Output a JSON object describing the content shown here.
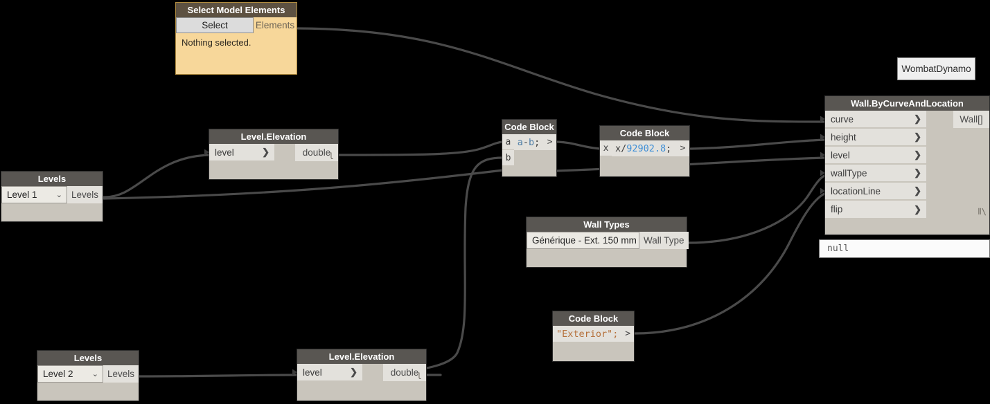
{
  "app": {
    "background": "#000000",
    "wire_color": "#4a4a4a",
    "header_color": "#595652",
    "node_body_color": "#c9c5bc",
    "port_color": "#e3e1dc",
    "select_node_color": "#f7d79a"
  },
  "nodes": {
    "select_model_elements": {
      "title": "Select Model Elements",
      "button_label": "Select",
      "output_label": "Elements",
      "status_text": "Nothing selected."
    },
    "levels_1": {
      "title": "Levels",
      "selected_value": "Level 1",
      "output_label": "Levels"
    },
    "levels_2": {
      "title": "Levels",
      "selected_value": "Level 2",
      "output_label": "Levels"
    },
    "level_elevation_1": {
      "title": "Level.Elevation",
      "input_label": "level",
      "output_label": "double"
    },
    "level_elevation_2": {
      "title": "Level.Elevation",
      "input_label": "level",
      "output_label": "double"
    },
    "code_block_1": {
      "title": "Code Block",
      "input_a": "a",
      "input_b": "b",
      "code": "a-b;",
      "code_tokens": [
        {
          "text": "a",
          "type": "id"
        },
        {
          "text": "-",
          "type": "plain"
        },
        {
          "text": "b",
          "type": "id"
        },
        {
          "text": ";",
          "type": "plain"
        }
      ],
      "output_label": ">"
    },
    "code_block_2": {
      "title": "Code Block",
      "input_x": "x",
      "code": "x/92902.8;",
      "code_tokens": [
        {
          "text": "x/",
          "type": "plain"
        },
        {
          "text": "92902.8",
          "type": "num"
        },
        {
          "text": ";",
          "type": "plain"
        }
      ],
      "output_label": ">"
    },
    "code_block_3": {
      "title": "Code Block",
      "code": "\"Exterior\";",
      "code_tokens": [
        {
          "text": "\"Exterior\"",
          "type": "str"
        },
        {
          "text": ";",
          "type": "plain"
        }
      ],
      "output_label": ">"
    },
    "wall_types": {
      "title": "Wall Types",
      "selected_value": "Générique - Ext. 150 mm",
      "output_label": "Wall Type"
    },
    "wall_by_curve_and_location": {
      "title": "Wall.ByCurveAndLocation",
      "inputs": [
        {
          "label": "curve"
        },
        {
          "label": "height"
        },
        {
          "label": "level"
        },
        {
          "label": "wallType"
        },
        {
          "label": "locationLine"
        },
        {
          "label": "flip"
        }
      ],
      "output_label": "Wall[]",
      "resize_glyph": "⦀\\",
      "tooltip_value": "null"
    },
    "wombat_note": {
      "text": "WombatDynamo"
    }
  },
  "glyphs": {
    "chevron_right": "❯",
    "caret_down": "⌄",
    "preview_mark": "l"
  }
}
